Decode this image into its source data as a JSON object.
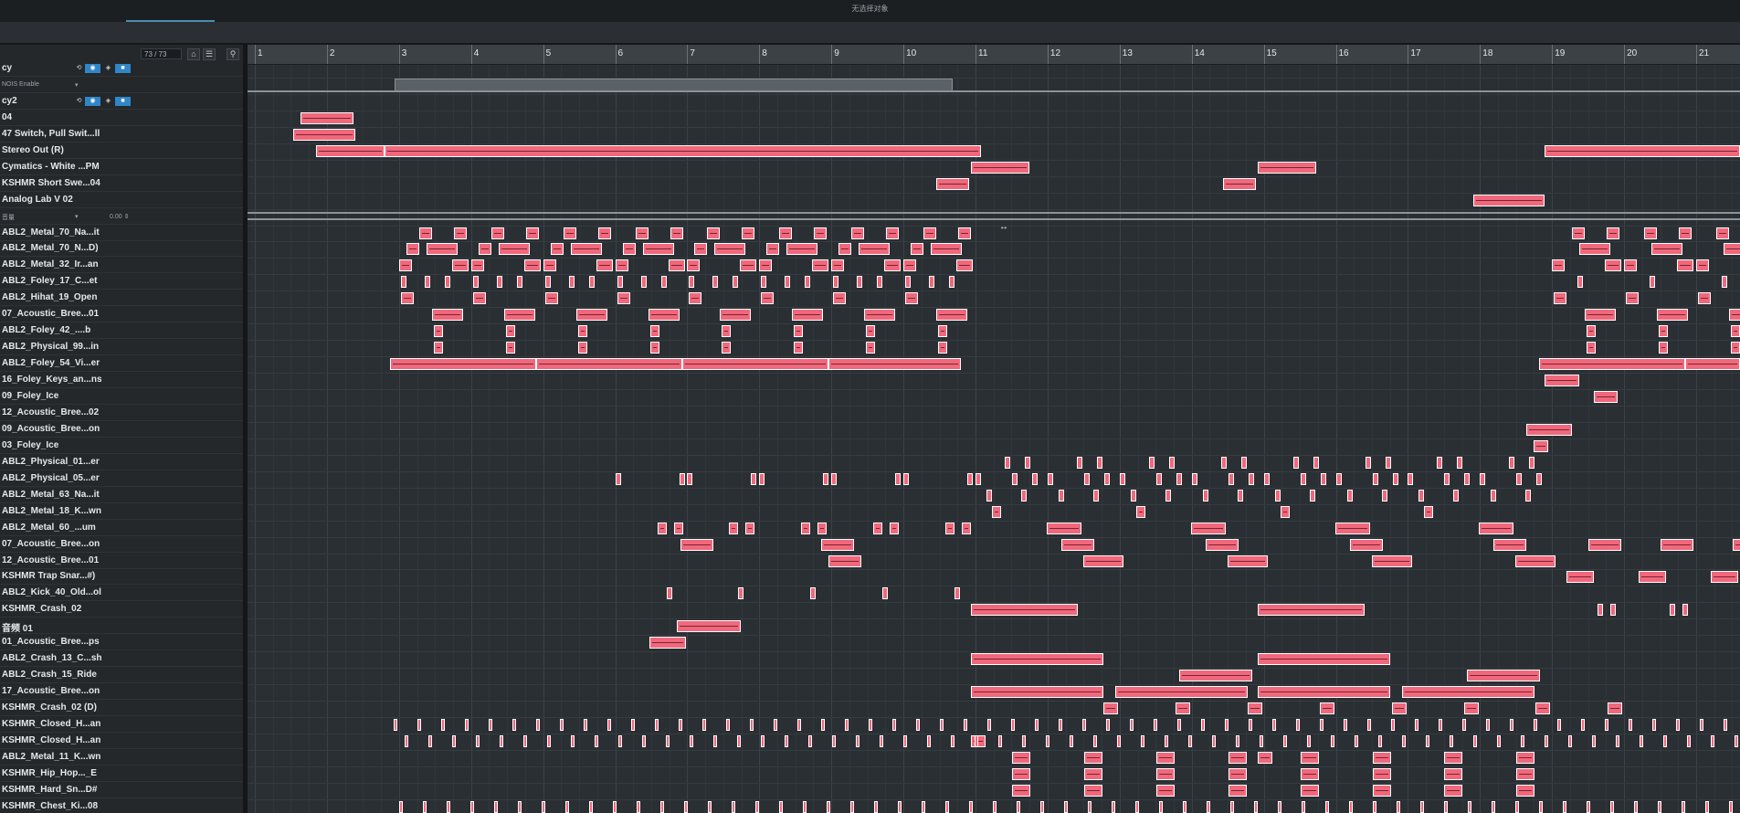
{
  "window": {
    "title": "无选择对象"
  },
  "track_header": {
    "count": "73 / 73"
  },
  "ruler": {
    "bars": [
      "1",
      "2",
      "3",
      "4",
      "5",
      "6",
      "7",
      "8",
      "9",
      "10",
      "11",
      "12",
      "13",
      "14",
      "15",
      "16",
      "17",
      "18",
      "19",
      "20",
      "21"
    ]
  },
  "tracks": [
    {
      "name": "cy",
      "kind": "fx"
    },
    {
      "name": "NOIS Enable",
      "kind": "auto"
    },
    {
      "name": "cy2",
      "kind": "fx"
    },
    {
      "name": "04",
      "kind": "audio"
    },
    {
      "name": "47 Switch, Pull Swit...ll",
      "kind": "audio"
    },
    {
      "name": "Stereo Out (R)",
      "kind": "audio"
    },
    {
      "name": "Cymatics - White ...PM",
      "kind": "audio"
    },
    {
      "name": "KSHMR Short Swe...04",
      "kind": "audio"
    },
    {
      "name": "Analog Lab V 02",
      "kind": "audio"
    },
    {
      "name": "音量",
      "kind": "auto",
      "value": "0.00"
    },
    {
      "name": "ABL2_Metal_70_Na...it",
      "kind": "audio"
    },
    {
      "name": "ABL2_Metal_70_N...D)",
      "kind": "audio"
    },
    {
      "name": "ABL2_Metal_32_Ir...an",
      "kind": "audio"
    },
    {
      "name": "ABL2_Foley_17_C...et",
      "kind": "audio"
    },
    {
      "name": "ABL2_Hihat_19_Open",
      "kind": "audio"
    },
    {
      "name": "07_Acoustic_Bree...01",
      "kind": "audio"
    },
    {
      "name": "ABL2_Foley_42_....b",
      "kind": "audio"
    },
    {
      "name": "ABL2_Physical_99...in",
      "kind": "audio"
    },
    {
      "name": "ABL2_Foley_54_Vi...er",
      "kind": "audio"
    },
    {
      "name": "16_Foley_Keys_an...ns",
      "kind": "audio"
    },
    {
      "name": "09_Foley_Ice",
      "kind": "audio"
    },
    {
      "name": "12_Acoustic_Bree...02",
      "kind": "audio"
    },
    {
      "name": "09_Acoustic_Bree...on",
      "kind": "audio"
    },
    {
      "name": "03_Foley_Ice",
      "kind": "audio"
    },
    {
      "name": "ABL2_Physical_01...er",
      "kind": "audio"
    },
    {
      "name": "ABL2_Physical_05...er",
      "kind": "audio"
    },
    {
      "name": "ABL2_Metal_63_Na...it",
      "kind": "audio"
    },
    {
      "name": "ABL2_Metal_18_K...wn",
      "kind": "audio"
    },
    {
      "name": "ABL2_Metal_60_...um",
      "kind": "audio"
    },
    {
      "name": "07_Acoustic_Bree...on",
      "kind": "audio"
    },
    {
      "name": "12_Acoustic_Bree...01",
      "kind": "audio"
    },
    {
      "name": "KSHMR Trap Snar...#)",
      "kind": "audio"
    },
    {
      "name": "ABL2_Kick_40_Old...ol",
      "kind": "audio"
    },
    {
      "name": "KSHMR_Crash_02",
      "kind": "audio"
    },
    {
      "name": "音频 01",
      "kind": "audio"
    },
    {
      "name": "01_Acoustic_Bree...ps",
      "kind": "audio"
    },
    {
      "name": "ABL2_Crash_13_C...sh",
      "kind": "audio"
    },
    {
      "name": "ABL2_Crash_15_Ride",
      "kind": "audio"
    },
    {
      "name": "17_Acoustic_Bree...on",
      "kind": "audio"
    },
    {
      "name": "KSHMR_Crash_02 (D)",
      "kind": "audio"
    },
    {
      "name": "KSHMR_Closed_H...an",
      "kind": "audio"
    },
    {
      "name": "KSHMR_Closed_H...an",
      "kind": "audio"
    },
    {
      "name": "ABL2_Metal_11_K...wn",
      "kind": "audio"
    },
    {
      "name": "KSHMR_Hip_Hop..._E",
      "kind": "audio"
    },
    {
      "name": "KSHMR_Hard_Sn...D#",
      "kind": "audio"
    },
    {
      "name": "KSHMR_Chest_Ki...08",
      "kind": "audio"
    }
  ],
  "colors": {
    "clip": "#f0687c",
    "clip_border": "#ffffff",
    "arrange_bg": "#2a2f33",
    "accent": "#2f86c8"
  }
}
